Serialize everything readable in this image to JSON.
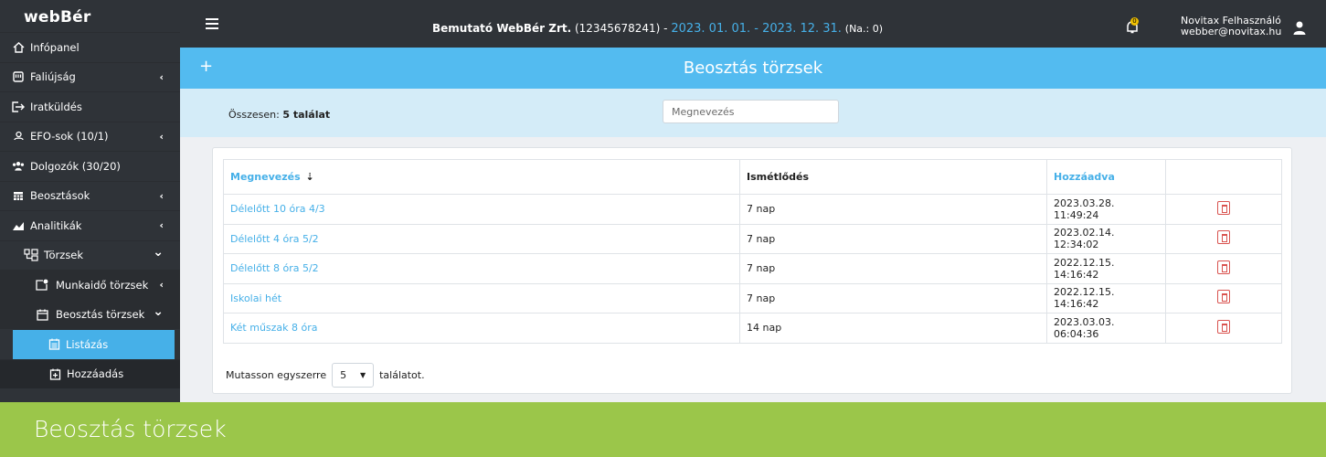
{
  "app": {
    "logo_web": "web",
    "logo_ber": "Bér"
  },
  "topbar": {
    "company_name": "Bemutató WebBér Zrt.",
    "company_id": "(12345678241)",
    "separator": " - ",
    "period": "2023. 01. 01. - 2023. 12. 31.",
    "na": "(Na.: 0)",
    "notification_count": "0",
    "user_name": "Novitax Felhasználó",
    "user_email": "webber@novitax.hu"
  },
  "sidebar": {
    "items": [
      {
        "label": "Infópanel",
        "icon": "home-icon",
        "chevron": ""
      },
      {
        "label": "Faliújság",
        "icon": "board-icon",
        "chevron": "‹"
      },
      {
        "label": "Iratküldés",
        "icon": "send-doc-icon",
        "chevron": ""
      },
      {
        "label": "EFO-sok (10/1)",
        "icon": "efo-icon",
        "chevron": "‹"
      },
      {
        "label": "Dolgozók (30/20)",
        "icon": "users-icon",
        "chevron": ""
      },
      {
        "label": "Beosztások",
        "icon": "calendar-grid-icon",
        "chevron": "‹"
      },
      {
        "label": "Analitikák",
        "icon": "chart-icon",
        "chevron": "‹"
      },
      {
        "label": "Törzsek",
        "icon": "tree-icon",
        "chevron": "⌄"
      }
    ],
    "sub_items": [
      {
        "label": "Munkaidő törzsek",
        "icon": "folder-pin-icon",
        "chevron": "‹"
      },
      {
        "label": "Beosztás törzsek",
        "icon": "calendar-icon",
        "chevron": "⌄"
      }
    ],
    "sub2_items": [
      {
        "label": "Listázás",
        "icon": "list-calendar-icon"
      },
      {
        "label": "Hozzáadás",
        "icon": "add-calendar-icon"
      }
    ]
  },
  "page": {
    "title": "Beosztás törzsek",
    "add_symbol": "+",
    "total_prefix": "Összesen: ",
    "total_value": "5 találat",
    "search_placeholder": "Megnevezés"
  },
  "table": {
    "columns": [
      "Megnevezés",
      "Ismétlődés",
      "Hozzáadva",
      ""
    ],
    "rows": [
      {
        "name": "Délelőtt 10 óra 4/3",
        "repeat": "7 nap",
        "added": "2023.03.28. 11:49:24"
      },
      {
        "name": "Délelőtt 4 óra 5/2",
        "repeat": "7 nap",
        "added": "2023.02.14. 12:34:02"
      },
      {
        "name": "Délelőtt 8 óra 5/2",
        "repeat": "7 nap",
        "added": "2022.12.15. 14:16:42"
      },
      {
        "name": "Iskolai hét",
        "repeat": "7 nap",
        "added": "2022.12.15. 14:16:42"
      },
      {
        "name": "Két műszak 8 óra",
        "repeat": "14 nap",
        "added": "2023.03.03. 06:04:36"
      }
    ]
  },
  "pager": {
    "prefix": "Mutasson egyszerre",
    "value": "5",
    "suffix": "találatot."
  },
  "banner": {
    "text": "Beosztás törzsek"
  },
  "colors": {
    "accent": "#46b0e8",
    "sidebar": "#2f3338",
    "banner": "#9bc64a",
    "danger": "#d9534f"
  }
}
